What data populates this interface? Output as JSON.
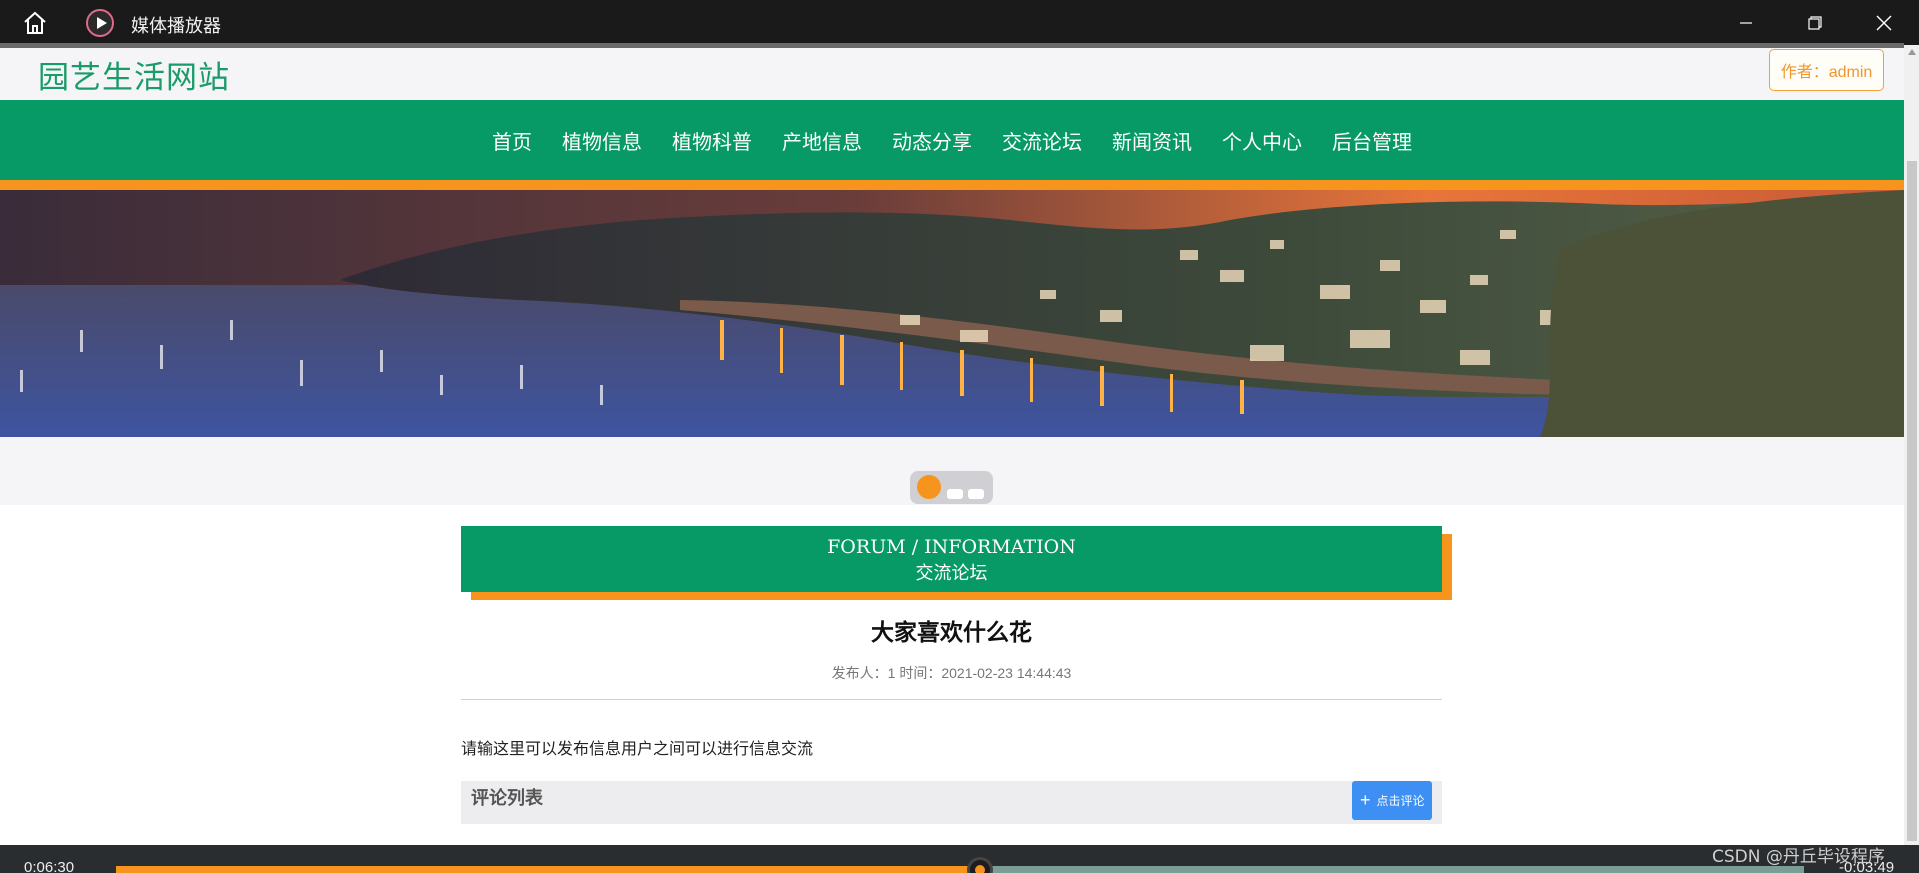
{
  "window": {
    "title": "媒体播放器",
    "icons": [
      "home-icon",
      "media-player-icon",
      "minimize-icon",
      "restore-icon",
      "close-icon"
    ]
  },
  "site": {
    "logo": "园艺生活网站",
    "author": "作者：admin"
  },
  "nav": {
    "items": [
      "首页",
      "植物信息",
      "植物科普",
      "产地信息",
      "动态分享",
      "交流论坛",
      "新闻资讯",
      "个人中心",
      "后台管理"
    ]
  },
  "carousel": {
    "slide_count": 3,
    "active_index": 0
  },
  "section": {
    "title_en": "FORUM / INFORMATION",
    "title_cn": "交流论坛"
  },
  "post": {
    "title": "大家喜欢什么花",
    "meta": "发布人：1 时间：2021-02-23 14:44:43",
    "body": "请输这里可以发布信息用户之间可以进行信息交流"
  },
  "comments": {
    "heading": "评论列表",
    "button_label": "点击评论"
  },
  "player": {
    "elapsed": "0:06:30",
    "remaining": "-0:03:49",
    "progress_fraction": 0.512
  },
  "watermark": "CSDN @丹丘毕设程序",
  "colors": {
    "brand_green": "#089a66",
    "accent_orange": "#f7941d",
    "button_blue": "#3d8ff4"
  }
}
